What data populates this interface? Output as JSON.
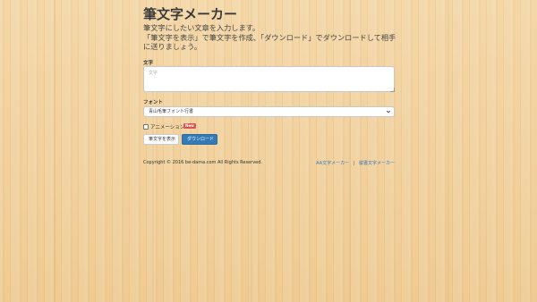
{
  "header": {
    "title": "筆文字メーカー",
    "lead_line1": "筆文字にしたい文章を入力します。",
    "lead_line2": "「筆文字を表示」で筆文字を作成、「ダウンロード」でダウンロードして相手",
    "lead_line3": "に送りましょう。"
  },
  "form": {
    "text_label": "文字",
    "text_placeholder": "文字",
    "text_value": "",
    "font_label": "フォント",
    "font_selected": "青山毛筆フォント行書",
    "animation_label": "アニメーション",
    "animation_checked": false,
    "new_badge": "New",
    "show_button": "筆文字を表示",
    "download_button": "ダウンロード"
  },
  "footer": {
    "copyright": "Copyright © 2016 be-dama.com All Rights Reserved.",
    "links": [
      "AA文字メーカー",
      "縦書文字メーカー"
    ],
    "separator": "|"
  },
  "colors": {
    "background": "#f0cf9a",
    "primary": "#337ab7",
    "badge": "#d9534f"
  }
}
